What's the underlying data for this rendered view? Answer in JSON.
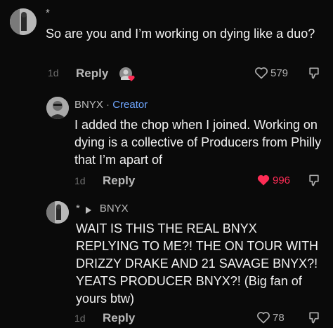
{
  "comments": [
    {
      "username": "*",
      "text": "So are you and I’m working on dying like a duo?",
      "age": "1d",
      "reply_label": "Reply",
      "likes": "579",
      "liked": false
    },
    {
      "username": "BNYX",
      "separator": "·",
      "badge": "Creator",
      "text": "I added the chop when I joined. Working on dying is a collective of Producers from Philly that I’m apart of",
      "age": "1d",
      "reply_label": "Reply",
      "likes": "996",
      "liked": true
    },
    {
      "username": "*",
      "reply_to": "BNYX",
      "text": "WAIT IS THIS THE REAL BNYX REPLYING TO ME?! THE ON TOUR WITH DRIZZY DRAKE AND 21 SAVAGE BNYX?! YEATS PRODUCER BNYX?! (Big fan of yours btw)",
      "age": "1d",
      "reply_label": "Reply",
      "likes": "78",
      "liked": false
    }
  ],
  "colors": {
    "background": "#0a0a0a",
    "liked_red": "#fe2c55",
    "creator_blue": "#6fa6ff"
  },
  "icons": {
    "like": "heart-icon",
    "dislike": "thumbs-down-icon",
    "creator_liked": "creator-liked-avatar-icon",
    "reply_arrow": "reply-arrow-icon"
  }
}
